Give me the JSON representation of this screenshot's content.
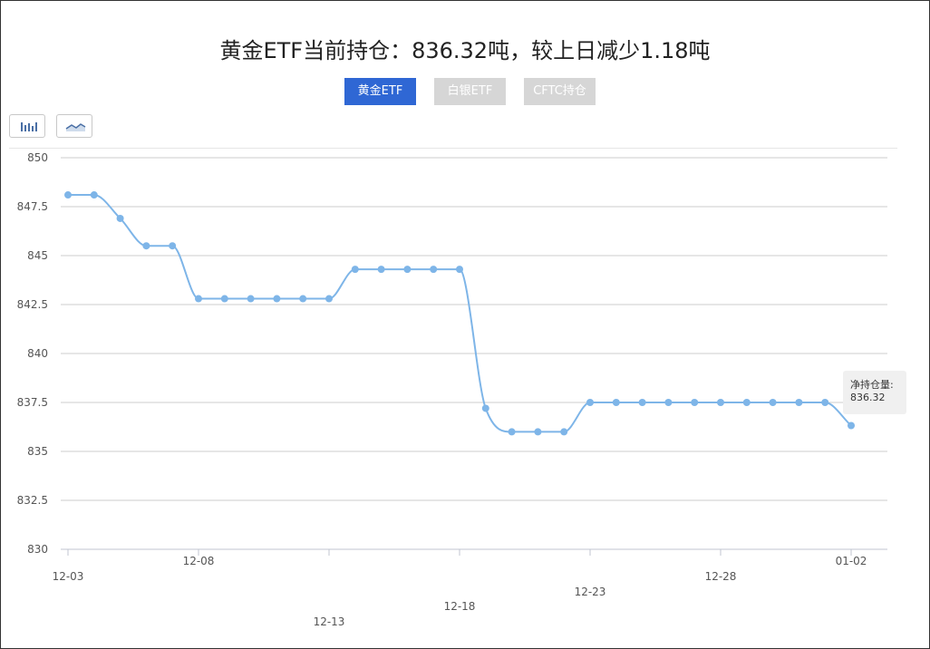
{
  "title": "黄金ETF当前持仓：836.32吨，较上日减少1.18吨",
  "tabs": [
    {
      "label": "黄金ETF",
      "active": true
    },
    {
      "label": "白银ETF",
      "active": false
    },
    {
      "label": "CFTC持仓",
      "active": false
    }
  ],
  "toolbar": {
    "bar_icon": "bar-chart-icon",
    "line_icon": "line-chart-icon"
  },
  "tooltip": {
    "label": "净持仓量:",
    "value": "836.32"
  },
  "colors": {
    "line": "#7eb5e8",
    "point": "#7eb5e8",
    "active_tab": "#2f67d4",
    "inactive_tab": "#d6d6d6",
    "grid": "#cccccc"
  },
  "chart_data": {
    "type": "line",
    "title": "",
    "xlabel": "",
    "ylabel": "",
    "ylim": [
      830,
      850
    ],
    "y_ticks": [
      "830",
      "832.5",
      "835",
      "837.5",
      "840",
      "842.5",
      "845",
      "847.5",
      "850"
    ],
    "x_tick_labels": [
      "12-03",
      "12-08",
      "12-13",
      "12-18",
      "12-23",
      "12-28",
      "01-02"
    ],
    "grid": true,
    "legend": "none",
    "series": [
      {
        "values": [
          848.1,
          848.1,
          846.9,
          845.5,
          845.5,
          842.8,
          842.8,
          842.8,
          842.8,
          842.8,
          842.8,
          844.3,
          844.3,
          844.3,
          844.3,
          844.3,
          837.2,
          836.0,
          836.0,
          836.0,
          837.5,
          837.5,
          837.5,
          837.5,
          837.5,
          837.5,
          837.5,
          837.5,
          837.5,
          837.5,
          836.32
        ]
      }
    ]
  }
}
